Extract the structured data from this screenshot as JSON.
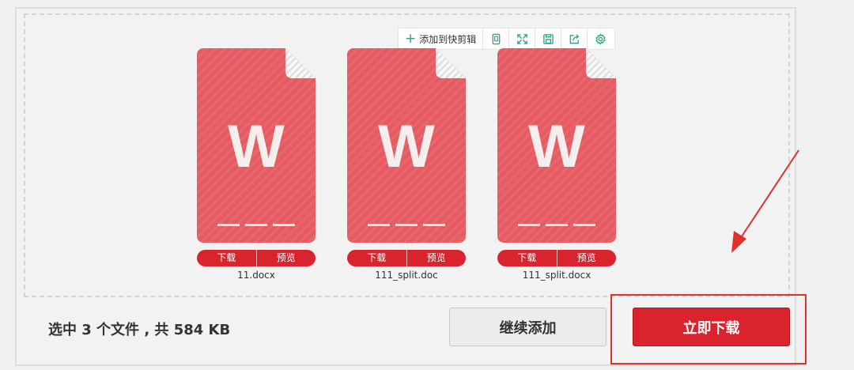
{
  "toolbar": {
    "add_label": "添加到快剪辑",
    "icons": [
      "page-icon",
      "fullscreen-icon",
      "save-icon",
      "share-icon",
      "settings-icon"
    ]
  },
  "files": [
    {
      "name": "11.docx",
      "download_label": "下载",
      "preview_label": "预览",
      "glyph": "W"
    },
    {
      "name": "111_split.doc",
      "download_label": "下载",
      "preview_label": "预览",
      "glyph": "W"
    },
    {
      "name": "111_split.docx",
      "download_label": "下载",
      "preview_label": "预览",
      "glyph": "W"
    }
  ],
  "summary": "选中 3 个文件 , 共 584 KB",
  "buttons": {
    "continue_label": "继续添加",
    "download_label": "立即下载"
  },
  "colors": {
    "doc_card": "#e55b62",
    "accent_red": "#d9242e",
    "annotation_red": "#e03030",
    "toolbar_icon": "#2aa676"
  }
}
